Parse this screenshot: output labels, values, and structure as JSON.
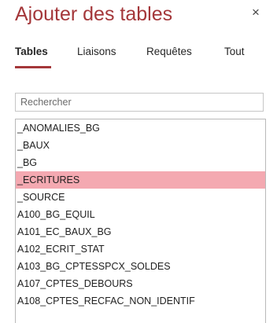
{
  "title": "Ajouter des tables",
  "close_glyph": "×",
  "tabs": [
    {
      "label": "Tables",
      "active": true
    },
    {
      "label": "Liaisons",
      "active": false
    },
    {
      "label": "Requêtes",
      "active": false
    },
    {
      "label": "Tout",
      "active": false
    }
  ],
  "search": {
    "placeholder": "Rechercher",
    "value": ""
  },
  "items": [
    {
      "label": "_ANOMALIES_BG",
      "selected": false
    },
    {
      "label": "_BAUX",
      "selected": false
    },
    {
      "label": "_BG",
      "selected": false
    },
    {
      "label": "_ECRITURES",
      "selected": true
    },
    {
      "label": "_SOURCE",
      "selected": false
    },
    {
      "label": "A100_BG_EQUIL",
      "selected": false
    },
    {
      "label": "A101_EC_BAUX_BG",
      "selected": false
    },
    {
      "label": "A102_ECRIT_STAT",
      "selected": false
    },
    {
      "label": "A103_BG_CPTESSPCX_SOLDES",
      "selected": false
    },
    {
      "label": "A107_CPTES_DEBOURS",
      "selected": false
    },
    {
      "label": "A108_CPTES_RECFAC_NON_IDENTIF",
      "selected": false
    }
  ],
  "colors": {
    "accent": "#a4373a",
    "selection": "#f4a9b1"
  }
}
